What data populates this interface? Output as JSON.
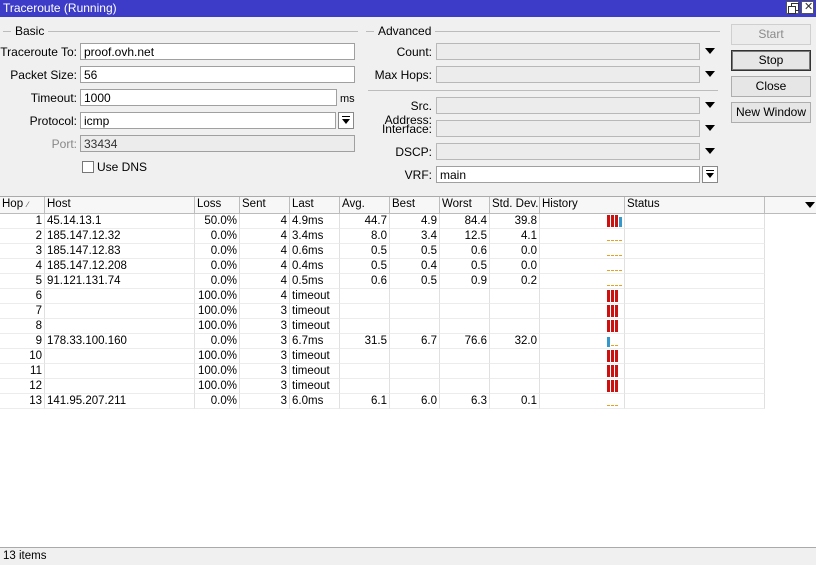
{
  "window": {
    "title": "Traceroute (Running)"
  },
  "basic": {
    "legend": "Basic",
    "traceroute_to_label": "Traceroute To:",
    "traceroute_to": "proof.ovh.net",
    "packet_size_label": "Packet Size:",
    "packet_size": "56",
    "timeout_label": "Timeout:",
    "timeout": "1000",
    "timeout_unit": "ms",
    "protocol_label": "Protocol:",
    "protocol": "icmp",
    "port_label": "Port:",
    "port": "33434",
    "use_dns_label": "Use DNS",
    "use_dns": false
  },
  "advanced": {
    "legend": "Advanced",
    "count_label": "Count:",
    "count": "",
    "max_hops_label": "Max Hops:",
    "max_hops": "",
    "src_address_label": "Src. Address:",
    "src_address": "",
    "interface_label": "Interface:",
    "interface": "",
    "dscp_label": "DSCP:",
    "dscp": "",
    "vrf_label": "VRF:",
    "vrf": "main"
  },
  "buttons": {
    "start": "Start",
    "stop": "Stop",
    "close": "Close",
    "new_window": "New Window"
  },
  "table": {
    "columns": [
      "Hop",
      "Host",
      "Loss",
      "Sent",
      "Last",
      "Avg.",
      "Best",
      "Worst",
      "Std. Dev.",
      "History",
      "Status"
    ],
    "rows": [
      {
        "hop": "1",
        "host": "45.14.13.1",
        "loss": "50.0%",
        "sent": "4",
        "last": "4.9ms",
        "avg": "44.7",
        "best": "4.9",
        "worst": "84.4",
        "std": "39.8",
        "history": "r-r-r-b"
      },
      {
        "hop": "2",
        "host": "185.147.12.32",
        "loss": "0.0%",
        "sent": "4",
        "last": "3.4ms",
        "avg": "8.0",
        "best": "3.4",
        "worst": "12.5",
        "std": "4.1",
        "history": "o-o-o-o"
      },
      {
        "hop": "3",
        "host": "185.147.12.83",
        "loss": "0.0%",
        "sent": "4",
        "last": "0.6ms",
        "avg": "0.5",
        "best": "0.5",
        "worst": "0.6",
        "std": "0.0",
        "history": "o-o-o-o"
      },
      {
        "hop": "4",
        "host": "185.147.12.208",
        "loss": "0.0%",
        "sent": "4",
        "last": "0.4ms",
        "avg": "0.5",
        "best": "0.4",
        "worst": "0.5",
        "std": "0.0",
        "history": "o-o-o-o"
      },
      {
        "hop": "5",
        "host": "91.121.131.74",
        "loss": "0.0%",
        "sent": "4",
        "last": "0.5ms",
        "avg": "0.6",
        "best": "0.5",
        "worst": "0.9",
        "std": "0.2",
        "history": "o-o-o-o"
      },
      {
        "hop": "6",
        "host": "",
        "loss": "100.0%",
        "sent": "4",
        "last": "timeout",
        "avg": "",
        "best": "",
        "worst": "",
        "std": "",
        "history": "r-r-r"
      },
      {
        "hop": "7",
        "host": "",
        "loss": "100.0%",
        "sent": "3",
        "last": "timeout",
        "avg": "",
        "best": "",
        "worst": "",
        "std": "",
        "history": "r-r-r"
      },
      {
        "hop": "8",
        "host": "",
        "loss": "100.0%",
        "sent": "3",
        "last": "timeout",
        "avg": "",
        "best": "",
        "worst": "",
        "std": "",
        "history": "r-r-r"
      },
      {
        "hop": "9",
        "host": "178.33.100.160",
        "loss": "0.0%",
        "sent": "3",
        "last": "6.7ms",
        "avg": "31.5",
        "best": "6.7",
        "worst": "76.6",
        "std": "32.0",
        "history": "b-o-o"
      },
      {
        "hop": "10",
        "host": "",
        "loss": "100.0%",
        "sent": "3",
        "last": "timeout",
        "avg": "",
        "best": "",
        "worst": "",
        "std": "",
        "history": "r-r-r"
      },
      {
        "hop": "11",
        "host": "",
        "loss": "100.0%",
        "sent": "3",
        "last": "timeout",
        "avg": "",
        "best": "",
        "worst": "",
        "std": "",
        "history": "r-r-r"
      },
      {
        "hop": "12",
        "host": "",
        "loss": "100.0%",
        "sent": "3",
        "last": "timeout",
        "avg": "",
        "best": "",
        "worst": "",
        "std": "",
        "history": "r-r-r"
      },
      {
        "hop": "13",
        "host": "141.95.207.211",
        "loss": "0.0%",
        "sent": "3",
        "last": "6.0ms",
        "avg": "6.1",
        "best": "6.0",
        "worst": "6.3",
        "std": "0.1",
        "history": "o-o-o"
      }
    ]
  },
  "status": {
    "items_count": "13 items"
  },
  "colors": {
    "titlebar": "#3c3cc8",
    "history_timeout": "#cc1111",
    "history_reply": "#e8a020",
    "history_high": "#3399cc"
  }
}
